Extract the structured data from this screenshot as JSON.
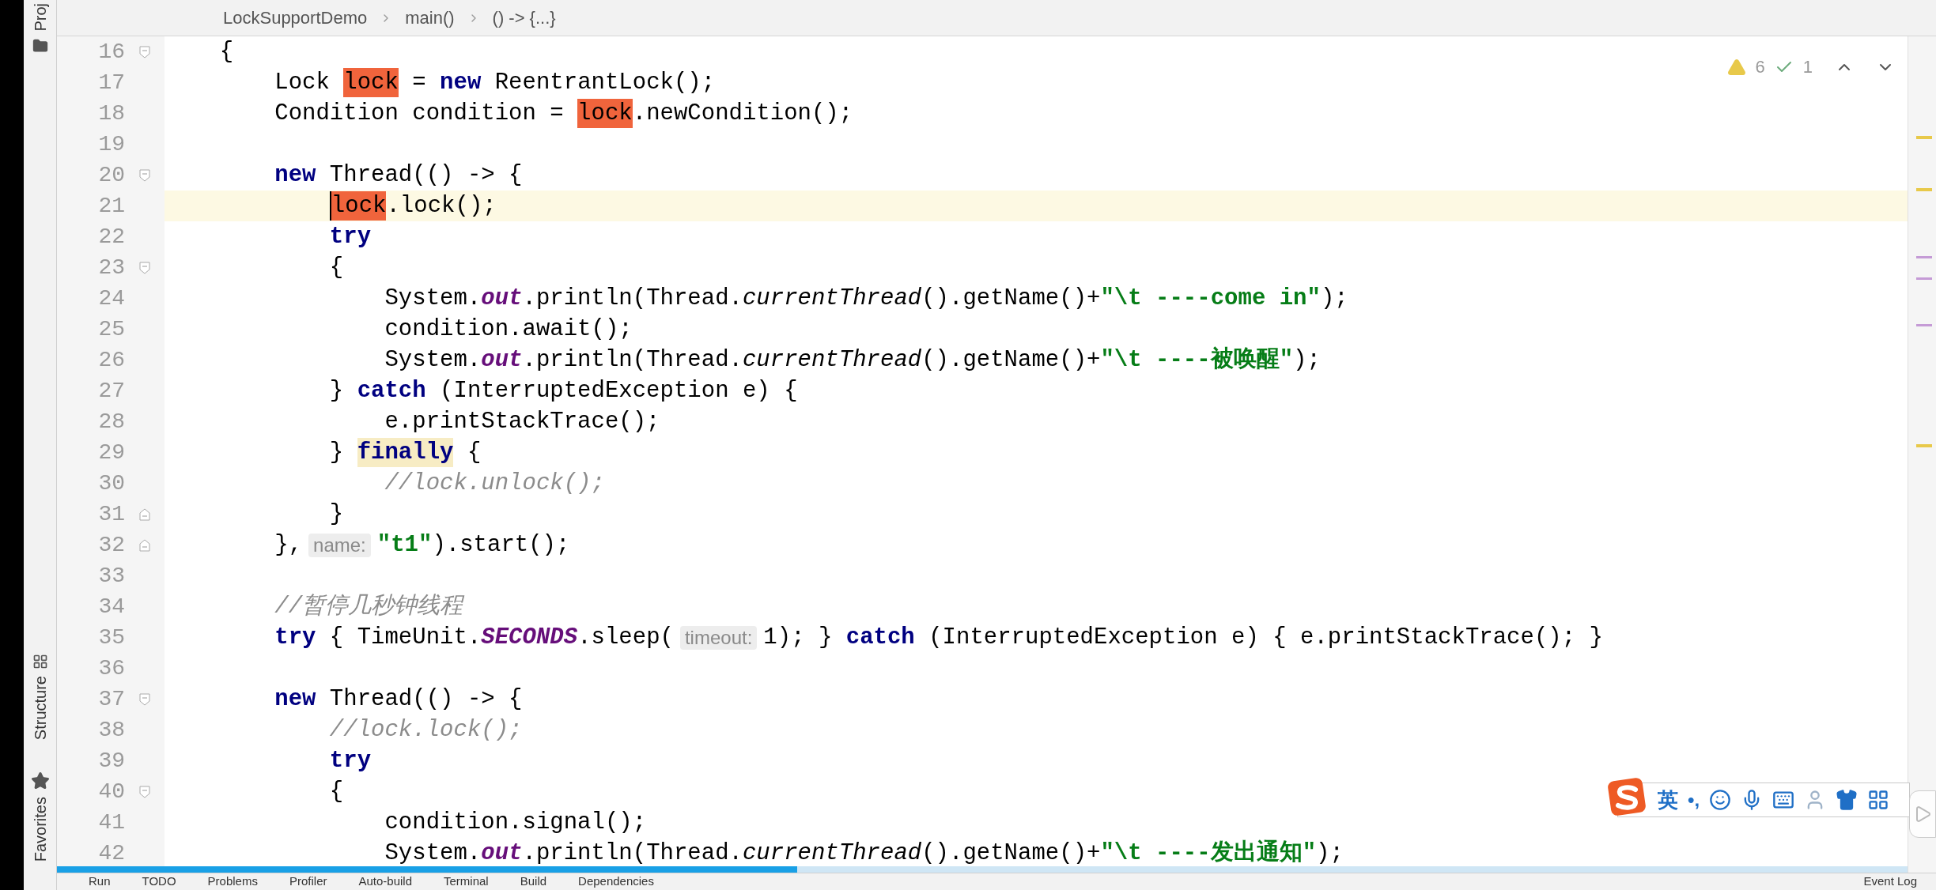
{
  "tool_strip": [
    {
      "label": "Proj",
      "kind": "folder"
    },
    {
      "label": "Structure",
      "kind": "structure"
    },
    {
      "label": "Favorites",
      "kind": "star"
    }
  ],
  "breadcrumbs": [
    "LockSupportDemo",
    "main()",
    "() -> {...}"
  ],
  "inspections": {
    "warnings": "6",
    "weak_warnings": "1"
  },
  "lines": [
    {
      "number": "16",
      "fold_start": true,
      "current": false,
      "tokens": [
        {
          "kind": "plain",
          "text": "    {"
        }
      ]
    },
    {
      "number": "17",
      "current": false,
      "tokens": [
        {
          "kind": "plain",
          "text": "        Lock "
        },
        {
          "kind": "occurrence",
          "text": "lock"
        },
        {
          "kind": "plain",
          "text": " = "
        },
        {
          "kind": "keyword",
          "text": "new"
        },
        {
          "kind": "plain",
          "text": " ReentrantLock();"
        }
      ]
    },
    {
      "number": "18",
      "current": false,
      "tokens": [
        {
          "kind": "plain",
          "text": "        Condition condition = "
        },
        {
          "kind": "occurrence",
          "text": "lock"
        },
        {
          "kind": "plain",
          "text": ".newCondition();"
        }
      ]
    },
    {
      "number": "19",
      "current": false
    },
    {
      "number": "20",
      "fold_start": true,
      "current": false,
      "tokens": [
        {
          "kind": "keyword",
          "text": "        new"
        },
        {
          "kind": "plain",
          "text": " Thread(() -> {"
        }
      ]
    },
    {
      "number": "21",
      "current": true,
      "tokens": [
        {
          "kind": "occurrence",
          "text": "            lock"
        },
        {
          "kind": "plain",
          "text": ".lock();"
        }
      ]
    },
    {
      "number": "22",
      "current": false,
      "tokens": [
        {
          "kind": "keyword",
          "text": "            try"
        }
      ]
    },
    {
      "number": "23",
      "fold_start": true,
      "current": false,
      "tokens": [
        {
          "kind": "plain",
          "text": "            {"
        }
      ]
    },
    {
      "number": "24",
      "current": false,
      "tokens": [
        {
          "kind": "plain",
          "text": "                System."
        },
        {
          "kind": "static_field",
          "text": "out"
        },
        {
          "kind": "plain",
          "text": ".println(Thread."
        },
        {
          "kind": "static_method",
          "text": "currentThread"
        },
        {
          "kind": "plain",
          "text": "().getName()+"
        },
        {
          "kind": "string",
          "text": "\"\\t ----come in\""
        },
        {
          "kind": "plain",
          "text": ");"
        }
      ]
    },
    {
      "number": "25",
      "current": false,
      "tokens": [
        {
          "kind": "plain",
          "text": "                condition.await();"
        }
      ]
    },
    {
      "number": "26",
      "current": false,
      "tokens": [
        {
          "kind": "plain",
          "text": "                System."
        },
        {
          "kind": "static_field",
          "text": "out"
        },
        {
          "kind": "plain",
          "text": ".println(Thread."
        },
        {
          "kind": "static_method",
          "text": "currentThread"
        },
        {
          "kind": "plain",
          "text": "().getName()+"
        },
        {
          "kind": "string",
          "text": "\"\\t ----被唤醒\""
        },
        {
          "kind": "plain",
          "text": ");"
        }
      ]
    },
    {
      "number": "27",
      "current": false,
      "tokens": [
        {
          "kind": "plain",
          "text": "            } "
        },
        {
          "kind": "keyword",
          "text": "catch"
        },
        {
          "kind": "plain",
          "text": " (InterruptedException e) {"
        }
      ]
    },
    {
      "number": "28",
      "current": false,
      "tokens": [
        {
          "kind": "plain",
          "text": "                e.printStackTrace();"
        }
      ]
    },
    {
      "number": "29",
      "current": false,
      "tokens": [
        {
          "kind": "plain",
          "text": "            } "
        },
        {
          "kind": "keyword_marked",
          "text": "finally"
        },
        {
          "kind": "plain",
          "text": " {"
        }
      ]
    },
    {
      "number": "30",
      "current": false,
      "tokens": [
        {
          "kind": "comment",
          "text": "                //lock.unlock();"
        }
      ]
    },
    {
      "number": "31",
      "fold_end": true,
      "current": false,
      "tokens": [
        {
          "kind": "plain",
          "text": "            }"
        }
      ]
    },
    {
      "number": "32",
      "fold_end": true,
      "current": false,
      "tokens": [
        {
          "kind": "plain",
          "text": "        },"
        },
        {
          "kind": "hint",
          "text": "name:"
        },
        {
          "kind": "string",
          "text": "\"t1\""
        },
        {
          "kind": "plain",
          "text": ").start();"
        }
      ]
    },
    {
      "number": "33",
      "current": false
    },
    {
      "number": "34",
      "current": false,
      "tokens": [
        {
          "kind": "comment",
          "text": "        //暂停几秒钟线程"
        }
      ]
    },
    {
      "number": "35",
      "current": false,
      "tokens": [
        {
          "kind": "keyword",
          "text": "        try"
        },
        {
          "kind": "plain",
          "text": " { TimeUnit."
        },
        {
          "kind": "static_field",
          "text": "SECONDS"
        },
        {
          "kind": "plain",
          "text": ".sleep("
        },
        {
          "kind": "hint",
          "text": "timeout:"
        },
        {
          "kind": "plain",
          "text": "1); } "
        },
        {
          "kind": "keyword",
          "text": "catch"
        },
        {
          "kind": "plain",
          "text": " (InterruptedException e) { e.printStackTrace(); }"
        }
      ]
    },
    {
      "number": "36",
      "current": false
    },
    {
      "number": "37",
      "fold_start": true,
      "current": false,
      "tokens": [
        {
          "kind": "keyword",
          "text": "        new"
        },
        {
          "kind": "plain",
          "text": " Thread(() -> {"
        }
      ]
    },
    {
      "number": "38",
      "current": false,
      "tokens": [
        {
          "kind": "comment",
          "text": "            //lock.lock();"
        }
      ]
    },
    {
      "number": "39",
      "current": false,
      "tokens": [
        {
          "kind": "keyword",
          "text": "            try"
        }
      ]
    },
    {
      "number": "40",
      "fold_start": true,
      "current": false,
      "tokens": [
        {
          "kind": "plain",
          "text": "            {"
        }
      ]
    },
    {
      "number": "41",
      "current": false,
      "tokens": [
        {
          "kind": "plain",
          "text": "                condition.signal();"
        }
      ]
    },
    {
      "number": "42",
      "current": false,
      "tokens": [
        {
          "kind": "plain",
          "text": "                System."
        },
        {
          "kind": "static_field",
          "text": "out"
        },
        {
          "kind": "plain",
          "text": ".println(Thread."
        },
        {
          "kind": "static_method",
          "text": "currentThread"
        },
        {
          "kind": "plain",
          "text": "().getName()+"
        },
        {
          "kind": "string",
          "text": "\"\\t ----发出通知\""
        },
        {
          "kind": "plain",
          "text": ");"
        }
      ]
    }
  ],
  "bottom_tools": [
    "Run",
    "TODO",
    "Problems",
    "Profiler",
    "Auto-build",
    "Terminal",
    "Build",
    "Dependencies"
  ],
  "event_log": "Event Log",
  "video_progress": {
    "level": 0.4
  },
  "ime_toolbar": {
    "mode": "英",
    "punctuation": "•,"
  }
}
